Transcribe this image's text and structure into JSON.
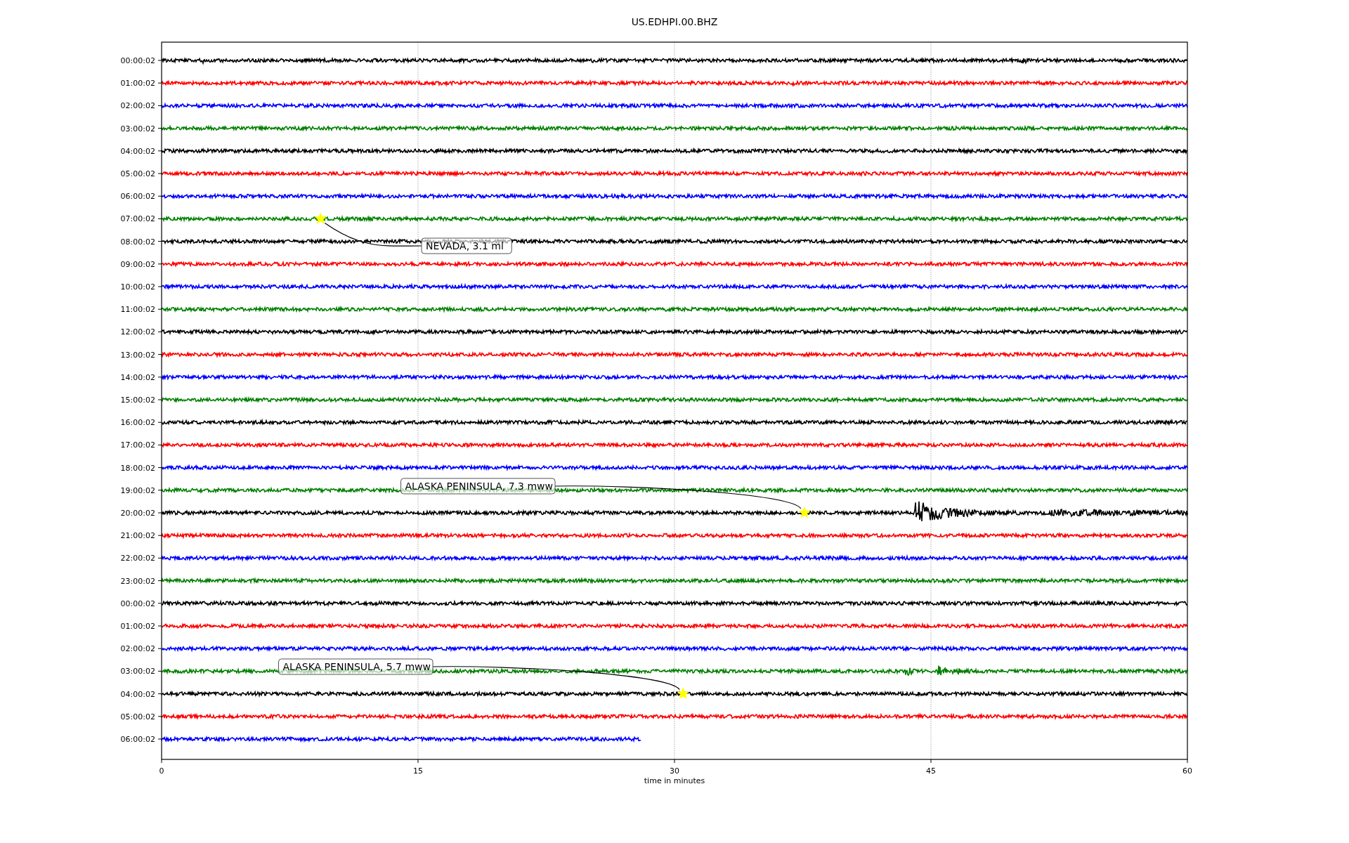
{
  "title": "US.EDHPI.00.BHZ",
  "traces": [
    {
      "label": "00:00:02",
      "color": "#000000",
      "level": 1
    },
    {
      "label": "01:00:02",
      "color": "#ff0000",
      "level": 1
    },
    {
      "label": "02:00:02",
      "color": "#0000ff",
      "level": 1
    },
    {
      "label": "03:00:02",
      "color": "#008000",
      "level": 1
    },
    {
      "label": "04:00:02",
      "color": "#000000",
      "level": 1
    },
    {
      "label": "05:00:02",
      "color": "#ff0000",
      "level": 1
    },
    {
      "label": "06:00:02",
      "color": "#0000ff",
      "level": 1
    },
    {
      "label": "07:00:02",
      "color": "#008000",
      "level": 1
    },
    {
      "label": "08:00:02",
      "color": "#000000",
      "level": 1
    },
    {
      "label": "09:00:02",
      "color": "#ff0000",
      "level": 1
    },
    {
      "label": "10:00:02",
      "color": "#0000ff",
      "level": 1
    },
    {
      "label": "11:00:02",
      "color": "#008000",
      "level": 1
    },
    {
      "label": "12:00:02",
      "color": "#000000",
      "level": 1
    },
    {
      "label": "13:00:02",
      "color": "#ff0000",
      "level": 1
    },
    {
      "label": "14:00:02",
      "color": "#0000ff",
      "level": 1
    },
    {
      "label": "15:00:02",
      "color": "#008000",
      "level": 1
    },
    {
      "label": "16:00:02",
      "color": "#000000",
      "level": 1
    },
    {
      "label": "17:00:02",
      "color": "#ff0000",
      "level": 1
    },
    {
      "label": "18:00:02",
      "color": "#0000ff",
      "level": 1
    },
    {
      "label": "19:00:02",
      "color": "#008000",
      "level": 1
    },
    {
      "label": "20:00:02",
      "color": "#000000",
      "level": 1
    },
    {
      "label": "21:00:02",
      "color": "#ff0000",
      "level": 1
    },
    {
      "label": "22:00:02",
      "color": "#0000ff",
      "level": 1
    },
    {
      "label": "23:00:02",
      "color": "#008000",
      "level": 1
    },
    {
      "label": "00:00:02",
      "color": "#000000",
      "level": 1
    },
    {
      "label": "01:00:02",
      "color": "#ff0000",
      "level": 1
    },
    {
      "label": "02:00:02",
      "color": "#0000ff",
      "level": 1
    },
    {
      "label": "03:00:02",
      "color": "#008000",
      "level": 1
    },
    {
      "label": "04:00:02",
      "color": "#000000",
      "level": 1
    },
    {
      "label": "05:00:02",
      "color": "#ff0000",
      "level": 1
    },
    {
      "label": "06:00:02",
      "color": "#0000ff",
      "level": 0.467
    }
  ],
  "events": [
    {
      "label": "NEVADA, 3.1 ml"
    },
    {
      "label": "ALASKA PENINSULA, 7.3 mww"
    },
    {
      "label": "ALASKA PENINSULA, 5.7 mww"
    }
  ],
  "x_ticks": [
    "0",
    "15",
    "30",
    "45",
    "60"
  ],
  "x_axis_label": "time in minutes"
}
